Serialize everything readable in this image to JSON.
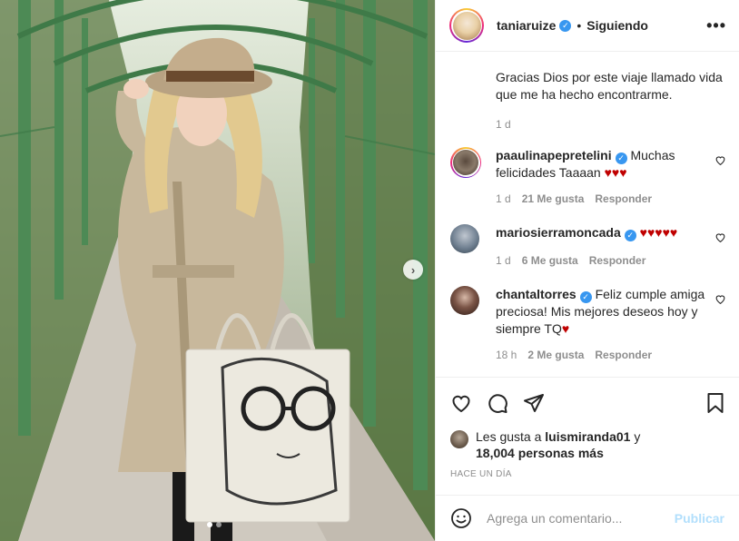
{
  "post": {
    "author": "taniaruize",
    "separator": "•",
    "follow_status": "Siguiendo",
    "more_label": "•••",
    "next_label": "›"
  },
  "caption": {
    "text": "Gracias Dios por este viaje llamado vida que me ha hecho encontrarme.",
    "time": "1 d"
  },
  "comments": [
    {
      "user": "paaulinapepretelini",
      "text": "Muchas felicidades Taaaan ",
      "hearts": "♥♥♥",
      "time": "1 d",
      "likes": "21 Me gusta",
      "reply": "Responder"
    },
    {
      "user": "mariosierramoncada",
      "text": "",
      "hearts": "♥♥♥♥♥",
      "time": "1 d",
      "likes": "6 Me gusta",
      "reply": "Responder"
    },
    {
      "user": "chantaltorres",
      "text": "Feliz cumple amiga preciosa! Mis mejores deseos hoy y siempre TQ",
      "hearts": "♥",
      "time": "18 h",
      "likes": "2 Me gusta",
      "reply": "Responder"
    }
  ],
  "likes": {
    "prefix": "Les gusta a ",
    "user": "luismiranda01",
    "mid": " y ",
    "count": "18,004 personas más"
  },
  "posted": "HACE UN DÍA",
  "add_comment": {
    "placeholder": "Agrega un comentario...",
    "publish": "Publicar"
  },
  "icons": {
    "like": "heart-icon",
    "comment": "comment-icon",
    "share": "share-icon",
    "save": "bookmark-icon",
    "emoji": "emoji-icon",
    "more": "more-icon",
    "verified": "verified-badge-icon"
  },
  "colors": {
    "verified": "#3897f0",
    "hearts": "#c00000",
    "publish_disabled": "#b2dffc",
    "meta": "#8e8e8e"
  }
}
